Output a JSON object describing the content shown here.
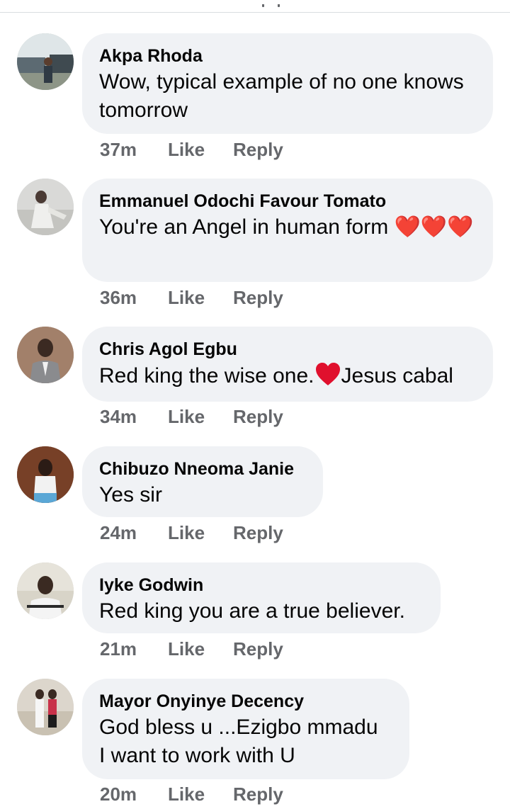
{
  "comments": [
    {
      "author": "Akpa Rhoda",
      "text": "Wow, typical example of no one knows tomorrow",
      "time": "37m",
      "like_label": "Like",
      "reply_label": "Reply"
    },
    {
      "author": "Emmanuel Odochi Favour Tomato",
      "text": "You're an Angel in human form ❤️❤️❤️",
      "time": "36m",
      "like_label": "Like",
      "reply_label": "Reply"
    },
    {
      "author": "Chris Agol Egbu",
      "text_before": "Red king the wise one.",
      "text_after": "Jesus cabal",
      "time": "34m",
      "like_label": "Like",
      "reply_label": "Reply"
    },
    {
      "author": "Chibuzo Nneoma Janie",
      "text": "Yes sir",
      "time": "24m",
      "like_label": "Like",
      "reply_label": "Reply"
    },
    {
      "author": "Iyke Godwin",
      "text": "Red king you are a true believer.",
      "time": "21m",
      "like_label": "Like",
      "reply_label": "Reply"
    },
    {
      "author": "Mayor Onyinye Decency",
      "text_line1": "God bless u ...Ezigbo mmadu",
      "text_line2": "I want to work with U",
      "time": "20m",
      "like_label": "Like",
      "reply_label": "Reply"
    }
  ],
  "icons": {
    "heart": "heart-emoji-icon",
    "avatar": "profile-photo"
  },
  "colors": {
    "bubble": "#f0f2f5",
    "meta_text": "#65676b",
    "heart": "#e0102d"
  }
}
